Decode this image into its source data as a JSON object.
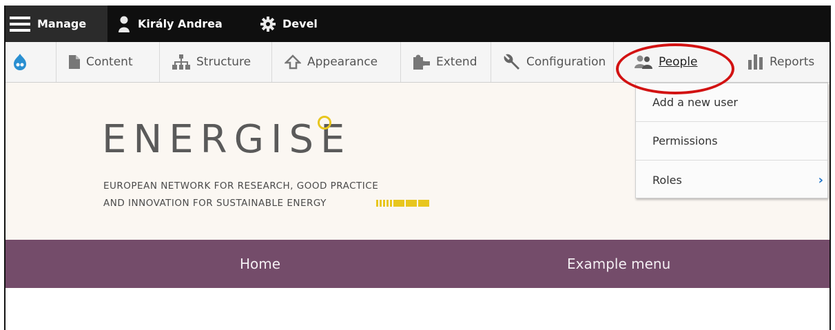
{
  "topbar": {
    "manage": "Manage",
    "user": "Király Andrea",
    "devel": "Devel"
  },
  "toolbar": {
    "items": [
      {
        "label": "Content",
        "icon": "file-icon"
      },
      {
        "label": "Structure",
        "icon": "sitemap-icon"
      },
      {
        "label": "Appearance",
        "icon": "brush-icon"
      },
      {
        "label": "Extend",
        "icon": "puzzle-icon"
      },
      {
        "label": "Configuration",
        "icon": "wrench-icon"
      },
      {
        "label": "People",
        "icon": "people-icon"
      },
      {
        "label": "Reports",
        "icon": "bar-chart-icon"
      }
    ]
  },
  "people_menu": {
    "items": [
      "Add a new user",
      "Permissions",
      "Roles"
    ]
  },
  "logo": {
    "word": "ENERGISE",
    "line1": "EUROPEAN NETWORK FOR RESEARCH, GOOD PRACTICE",
    "line2": "AND INNOVATION FOR SUSTAINABLE ENERGY"
  },
  "nav": {
    "items": [
      "Home",
      "Example menu"
    ]
  },
  "colors": {
    "admin_bar": "#0f0f0f",
    "nav_bar": "#744c6a",
    "highlight_ring": "#d21212",
    "logo_accent": "#e8c61e",
    "link_blue": "#1b72c9"
  }
}
